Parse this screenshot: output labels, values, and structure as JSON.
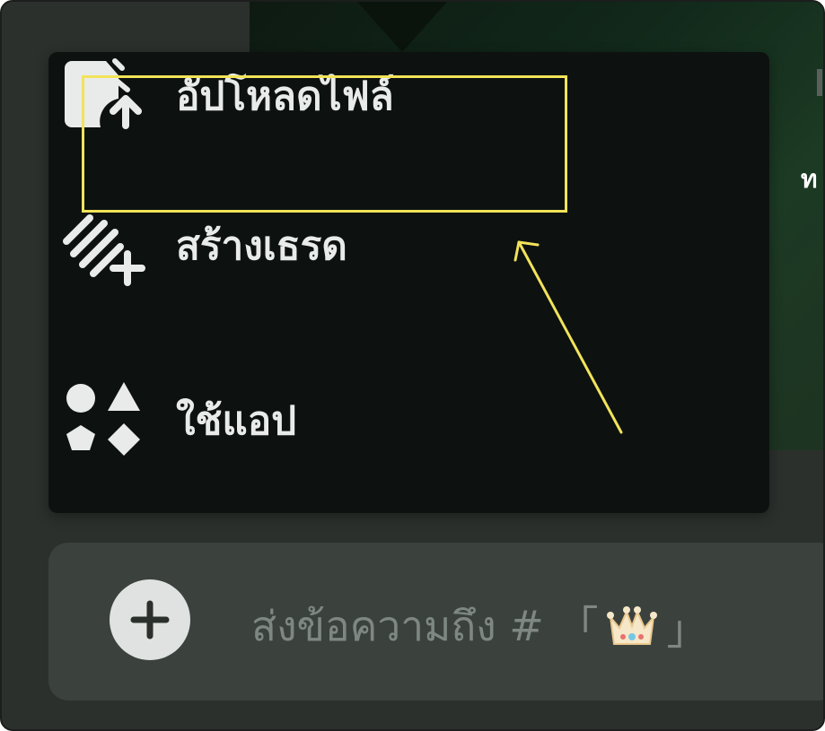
{
  "menu": {
    "items": [
      {
        "label": "อัปโหลดไฟล์",
        "icon": "upload-file-icon",
        "highlighted": true
      },
      {
        "label": "สร้างเธรด",
        "icon": "create-thread-icon",
        "highlighted": false
      },
      {
        "label": "ใช้แอป",
        "icon": "apps-icon",
        "highlighted": false
      }
    ]
  },
  "composer": {
    "placeholder_prefix": "ส่งข้อความถึง # 「",
    "placeholder_suffix": "」",
    "channel_icon": "crown-emoji",
    "add_icon": "plus-icon"
  },
  "background": {
    "partial_text": "ท"
  },
  "colors": {
    "menu_bg": "#0d1210",
    "highlight": "#f2e35a",
    "text": "#e9ebea",
    "placeholder": "#7e8782",
    "composer_bg": "#3b423e"
  }
}
